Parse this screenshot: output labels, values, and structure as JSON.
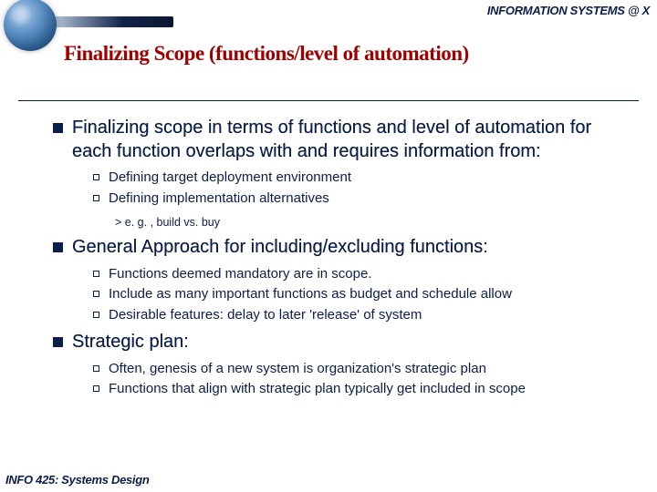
{
  "header": {
    "brand": "INFORMATION SYSTEMS @ X"
  },
  "title": "Finalizing Scope (functions/level of automation)",
  "bullets": [
    {
      "text": "Finalizing scope in terms of functions and level of automation for each function overlaps with and requires information from:",
      "sub": [
        {
          "text": "Defining target deployment environment"
        },
        {
          "text": "Defining implementation alternatives"
        }
      ],
      "subsub": "> e. g. , build vs. buy"
    },
    {
      "text": "General Approach for including/excluding functions:",
      "sub": [
        {
          "text": "Functions deemed mandatory are in scope."
        },
        {
          "text": "Include as many important functions as budget and schedule allow"
        },
        {
          "text": "Desirable features:  delay to later 'release' of system"
        }
      ]
    },
    {
      "text": "Strategic plan:",
      "sub": [
        {
          "text": "Often, genesis of a new system is organization's strategic plan"
        },
        {
          "text": "Functions that align with strategic plan typically get included in scope"
        }
      ]
    }
  ],
  "footer": "INFO 425: Systems Design"
}
